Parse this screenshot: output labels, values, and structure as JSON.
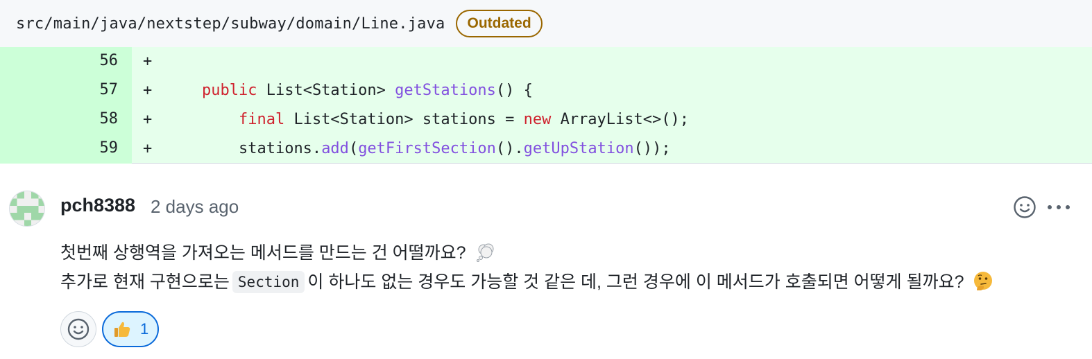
{
  "file": {
    "path": "src/main/java/nextstep/subway/domain/Line.java",
    "badge": "Outdated"
  },
  "diff": {
    "marker": "+",
    "lines": [
      {
        "num": "56"
      },
      {
        "num": "57",
        "indent": "    ",
        "kw": "public",
        "type": " List<Station> ",
        "fn": "getStations",
        "rest": "() {"
      },
      {
        "num": "58",
        "indent": "        ",
        "kw": "final",
        "type": " List<Station> stations = ",
        "kw2": "new",
        "rest": " ArrayList<>();"
      },
      {
        "num": "59",
        "indent": "        ",
        "obj": "stations.",
        "fn1": "add",
        "p1": "(",
        "fn2": "getFirstSection",
        "p2": "().",
        "fn3": "getUpStation",
        "rest": "());"
      }
    ]
  },
  "comment": {
    "author": "pch8388",
    "timestamp": "2 days ago",
    "line1": "첫번째 상행역을 가져오는 메서드를 만드는 건 어떨까요?",
    "line1_emoji": "thought-balloon-icon",
    "line2_before": "추가로 현재 구현으로는",
    "line2_code": "Section",
    "line2_after": "이 하나도 없는 경우도 가능할 것 같은 데, 그런 경우에 이 메서드가 호출되면 어떻게 될까요?",
    "line2_emoji": "thinking-face-icon"
  },
  "reactions": {
    "thumbs_up_count": "1"
  },
  "colors": {
    "accent": "#0969da",
    "added_bg": "#e6ffec",
    "added_num_bg": "#ccffd8",
    "keyword": "#cf222e",
    "function": "#8250df",
    "badge": "#9a6700"
  }
}
